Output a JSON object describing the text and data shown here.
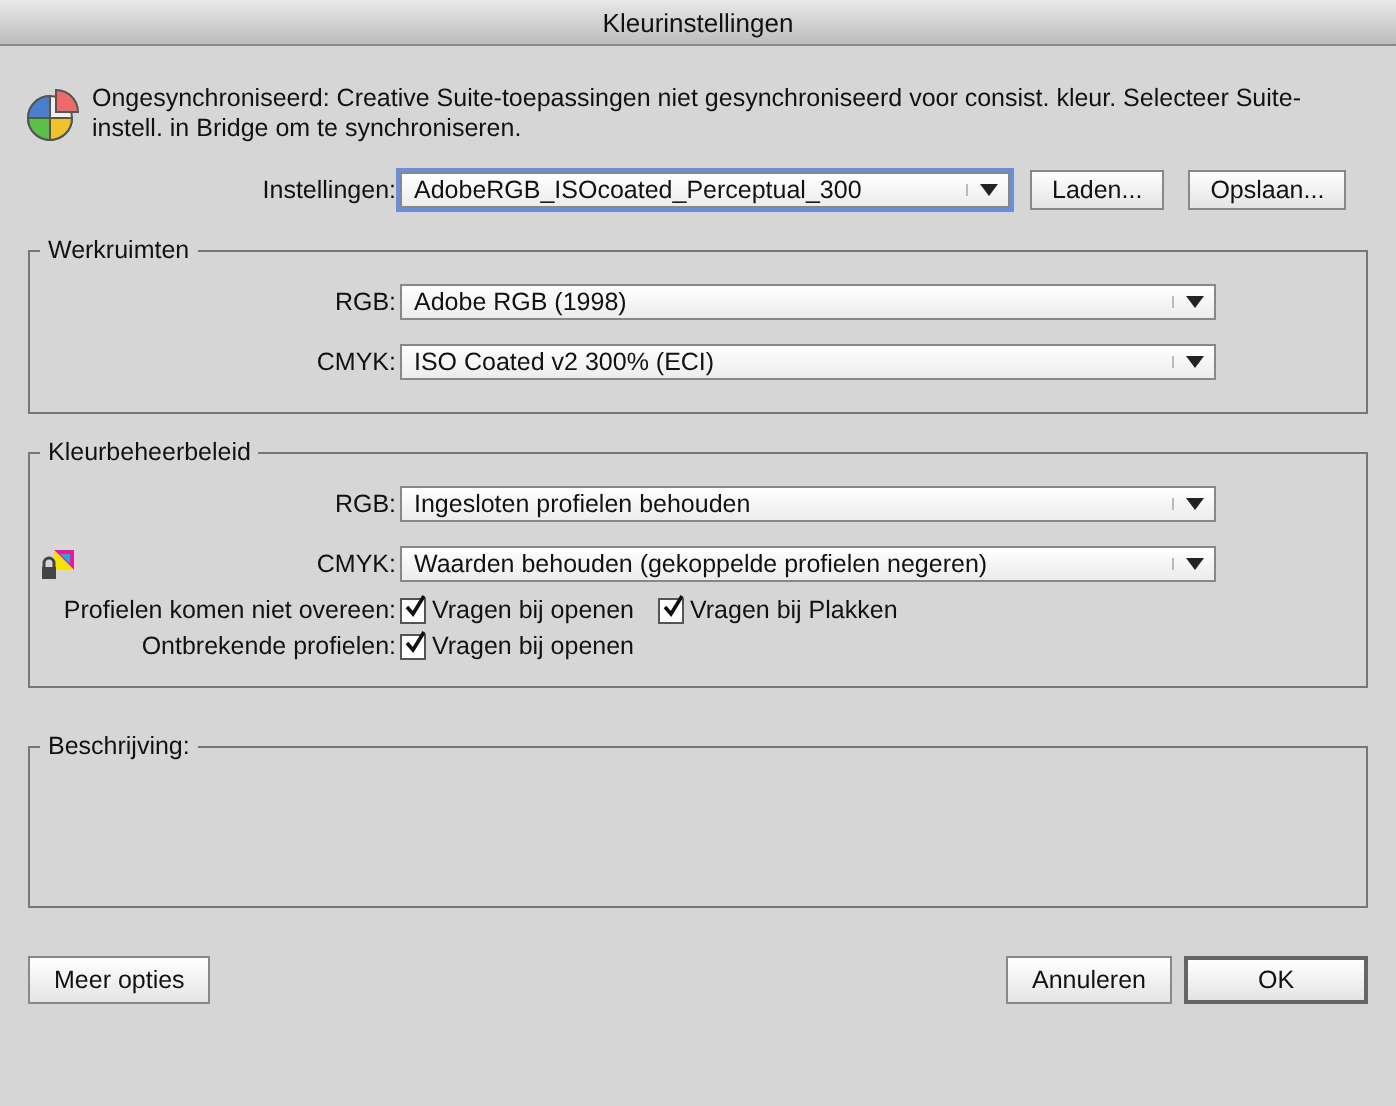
{
  "window": {
    "title": "Kleurinstellingen"
  },
  "message": "Ongesynchroniseerd: Creative Suite-toepassingen niet gesynchroniseerd voor consist. kleur. Selecteer Suite-instell. in Bridge om te synchroniseren.",
  "settings": {
    "label": "Instellingen:",
    "value": "AdobeRGB_ISOcoated_Perceptual_300",
    "buttons": [
      "Laden...",
      "Opslaan..."
    ]
  },
  "workspaces": {
    "title": "Werkruimten",
    "rows": [
      {
        "label": "RGB:",
        "value": "Adobe RGB (1998)"
      },
      {
        "label": "CMYK:",
        "value": "ISO Coated v2 300% (ECI)"
      }
    ]
  },
  "policies": {
    "title": "Kleurbeheerbeleid",
    "rows": [
      {
        "label": "RGB:",
        "value": "Ingesloten profielen behouden",
        "locked": false
      },
      {
        "label": "CMYK:",
        "value": "Waarden behouden (gekoppelde profielen negeren)",
        "locked": true
      }
    ],
    "checks": [
      {
        "label": "Profielen komen niet overeen:",
        "options": [
          {
            "label": "Vragen bij openen",
            "checked": true
          },
          {
            "label": "Vragen bij Plakken",
            "checked": true
          }
        ]
      },
      {
        "label": "Ontbrekende profielen:",
        "options": [
          {
            "label": "Vragen bij openen",
            "checked": true
          }
        ]
      }
    ]
  },
  "description": {
    "title": "Beschrijving:"
  },
  "footer": {
    "more": "Meer opties",
    "buttons": [
      {
        "label": "Annuleren",
        "default": false
      },
      {
        "label": "OK",
        "default": true
      }
    ]
  }
}
